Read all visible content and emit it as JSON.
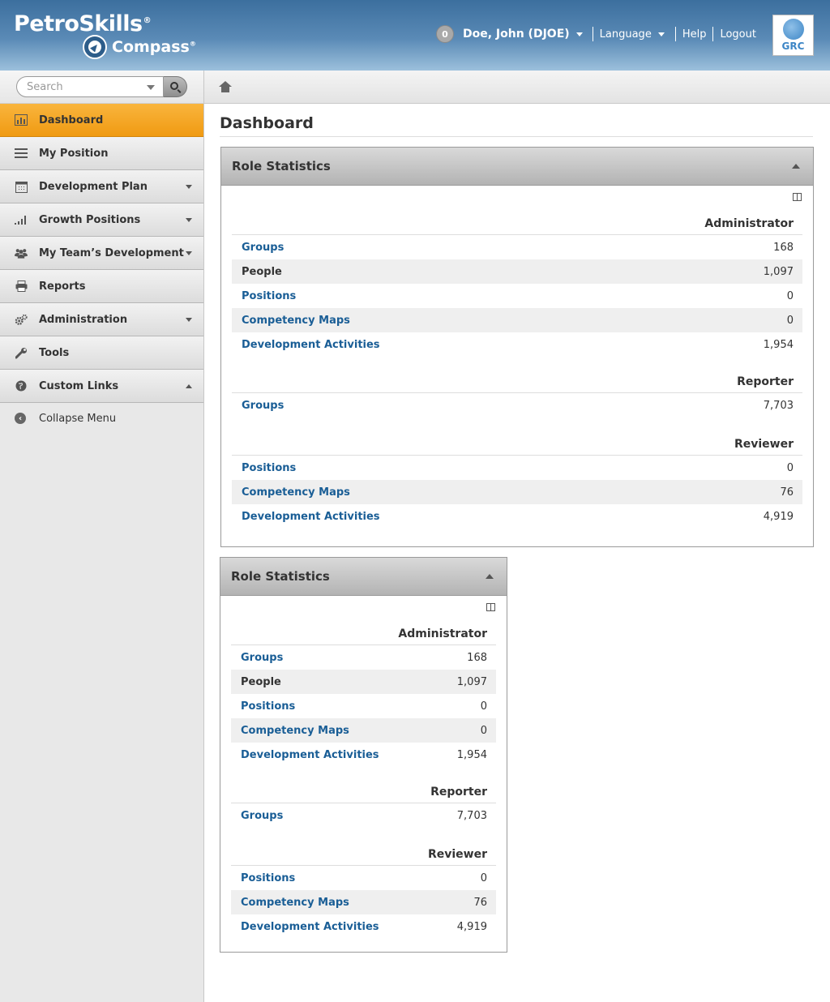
{
  "header": {
    "brand_top": "PetroSkills",
    "brand_bottom": "Compass",
    "notifications": "0",
    "user_name": "Doe, John (DJOE)",
    "language": "Language",
    "help": "Help",
    "logout": "Logout",
    "grc_label": "GRC"
  },
  "sidebar": {
    "search_placeholder": "Search",
    "items": [
      {
        "label": "Dashboard",
        "icon": "bar-chart-icon"
      },
      {
        "label": "My Position",
        "icon": "list-icon"
      },
      {
        "label": "Development Plan",
        "icon": "calendar-icon"
      },
      {
        "label": "Growth Positions",
        "icon": "signal-icon"
      },
      {
        "label": "My Team’s Development",
        "icon": "team-icon"
      },
      {
        "label": "Reports",
        "icon": "print-icon"
      },
      {
        "label": "Administration",
        "icon": "gears-icon"
      },
      {
        "label": "Tools",
        "icon": "wrench-icon"
      },
      {
        "label": "Custom Links",
        "icon": "globe-icon"
      }
    ],
    "collapse_label": "Collapse Menu"
  },
  "main": {
    "page_title": "Dashboard",
    "panels": [
      {
        "title": "Role Statistics",
        "sections": [
          {
            "role": "Administrator",
            "rows": [
              {
                "label": "Groups",
                "value": "168"
              },
              {
                "label": "People",
                "value": "1,097"
              },
              {
                "label": "Positions",
                "value": "0"
              },
              {
                "label": "Competency Maps",
                "value": "0"
              },
              {
                "label": "Development Activities",
                "value": "1,954"
              }
            ]
          },
          {
            "role": "Reporter",
            "rows": [
              {
                "label": "Groups",
                "value": "7,703"
              }
            ]
          },
          {
            "role": "Reviewer",
            "rows": [
              {
                "label": "Positions",
                "value": "0"
              },
              {
                "label": "Competency Maps",
                "value": "76"
              },
              {
                "label": "Development Activities",
                "value": "4,919"
              }
            ]
          }
        ]
      },
      {
        "title": "Role Statistics",
        "sections": [
          {
            "role": "Administrator",
            "rows": [
              {
                "label": "Groups",
                "value": "168"
              },
              {
                "label": "People",
                "value": "1,097"
              },
              {
                "label": "Positions",
                "value": "0"
              },
              {
                "label": "Competency Maps",
                "value": "0"
              },
              {
                "label": "Development Activities",
                "value": "1,954"
              }
            ]
          },
          {
            "role": "Reporter",
            "rows": [
              {
                "label": "Groups",
                "value": "7,703"
              }
            ]
          },
          {
            "role": "Reviewer",
            "rows": [
              {
                "label": "Positions",
                "value": "0"
              },
              {
                "label": "Competency Maps",
                "value": "76"
              },
              {
                "label": "Development Activities",
                "value": "4,919"
              }
            ]
          }
        ]
      }
    ]
  }
}
